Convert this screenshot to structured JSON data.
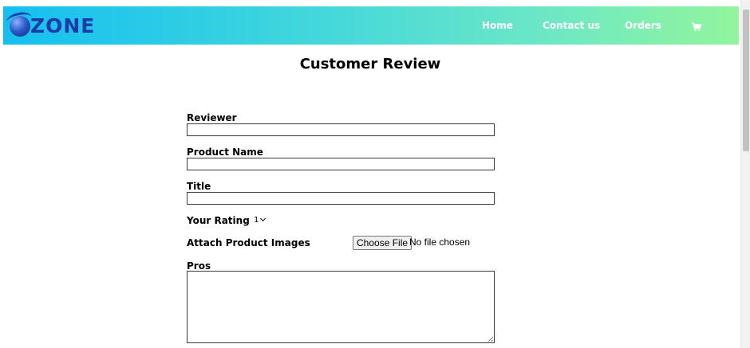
{
  "header": {
    "logo_text": "ZONE",
    "nav": {
      "home": "Home",
      "contact": "Contact us",
      "orders": "Orders"
    },
    "cart_icon": "shopping-cart-icon",
    "gradient": [
      "#14bff0",
      "#93f59c"
    ]
  },
  "page": {
    "title": "Customer Review"
  },
  "form": {
    "reviewer_label": "Reviewer",
    "reviewer_value": "",
    "product_label": "Product Name",
    "product_value": "",
    "title_label": "Title",
    "title_value": "",
    "rating_label": "Your Rating",
    "rating_value": "1",
    "images_label": "Attach Product Images",
    "file_button": "Choose File",
    "file_status": "No file chosen",
    "pros_label": "Pros",
    "pros_value": ""
  }
}
